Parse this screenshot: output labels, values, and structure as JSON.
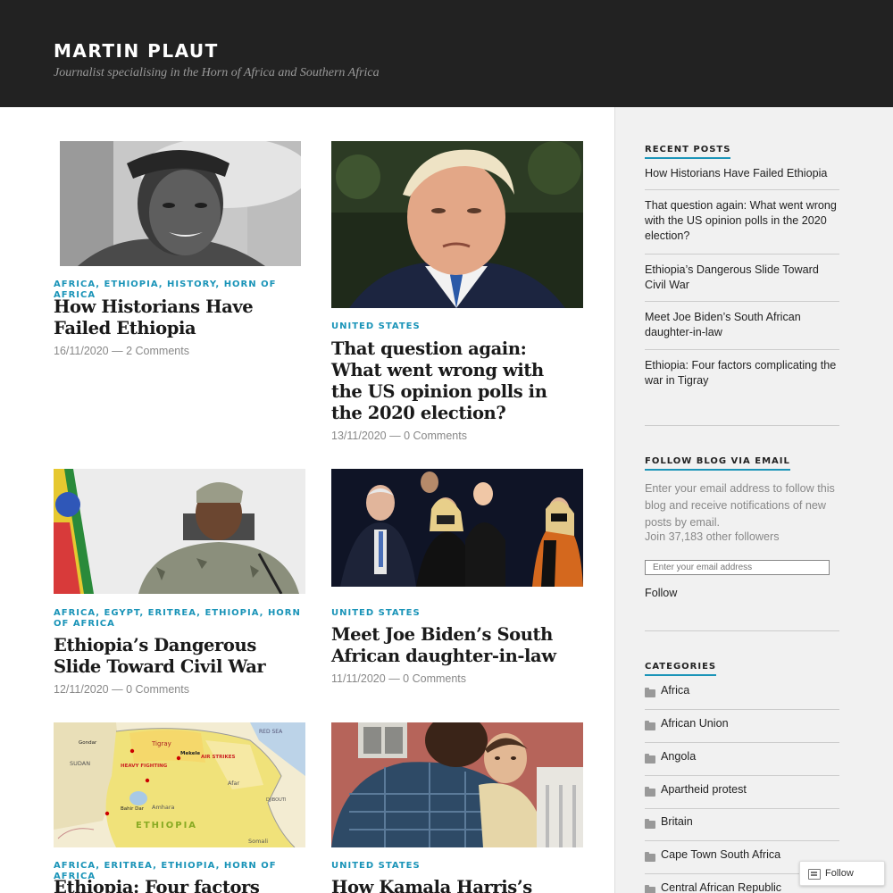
{
  "site": {
    "title": "MARTIN PLAUT",
    "description": "Journalist specialising in the Horn of Africa and Southern Africa"
  },
  "posts": [
    {
      "categories": [
        "AFRICA",
        "ETHIOPIA",
        "HISTORY",
        "HORN OF AFRICA"
      ],
      "title": "How Historians Have Failed Ethiopia",
      "date": "16/11/2020",
      "comments": "2 Comments",
      "image": "portrait-black-white"
    },
    {
      "categories": [
        "UNITED STATES"
      ],
      "title": "That question again: What went wrong with the US opinion polls in the 2020 election?",
      "date": "13/11/2020",
      "comments": "0 Comments",
      "image": "portrait-suit"
    },
    {
      "categories": [
        "AFRICA",
        "EGYPT",
        "ERITREA",
        "ETHIOPIA",
        "HORN OF AFRICA"
      ],
      "title": "Ethiopia’s Dangerous Slide Toward Civil War",
      "date": "12/11/2020",
      "comments": "0 Comments",
      "image": "man-camouflage-flag"
    },
    {
      "categories": [
        "UNITED STATES"
      ],
      "title": "Meet Joe Biden’s South African daughter-in-law",
      "date": "11/11/2020",
      "comments": "0 Comments",
      "image": "group-stage-night"
    },
    {
      "categories": [
        "AFRICA",
        "ERITREA",
        "ETHIOPIA",
        "HORN OF AFRICA"
      ],
      "title": "Ethiopia: Four factors",
      "image": "map-ethiopia",
      "map_labels": [
        "Tigray",
        "HEAVY FIGHTING",
        "AIR STRIKES",
        "ETHIOPIA",
        "SUDAN",
        "Afar",
        "Amhara",
        "Somali",
        "RED SEA",
        "DJIBOUTI",
        "Mekele",
        "Gondar",
        "Bahir Dar"
      ]
    },
    {
      "categories": [
        "UNITED STATES"
      ],
      "title": "How Kamala Harris’s",
      "image": "man-holding-child"
    }
  ],
  "sidebar": {
    "recent_posts": {
      "heading": "RECENT POSTS",
      "items": [
        "How Historians Have Failed Ethiopia",
        "That question again: What went wrong with the US opinion polls in the 2020 election?",
        "Ethiopia’s Dangerous Slide Toward Civil War",
        "Meet Joe Biden’s South African daughter-in-law",
        "Ethiopia: Four factors complicating the war in Tigray"
      ]
    },
    "follow": {
      "heading": "FOLLOW BLOG VIA EMAIL",
      "text": "Enter your email address to follow this blog and receive notifications of new posts by email.",
      "count": "Join 37,183 other followers",
      "placeholder": "Enter your email address",
      "button": "Follow"
    },
    "categories": {
      "heading": "CATEGORIES",
      "items": [
        "Africa",
        "African Union",
        "Angola",
        "Apartheid protest",
        "Britain",
        "Cape Town South Africa",
        "Central African Republic"
      ]
    }
  },
  "follow_pill": {
    "label": "Follow"
  },
  "colors": {
    "header_bg": "#222222",
    "accent": "#1a94b8",
    "sidebar_bg": "#f1f1f1"
  }
}
